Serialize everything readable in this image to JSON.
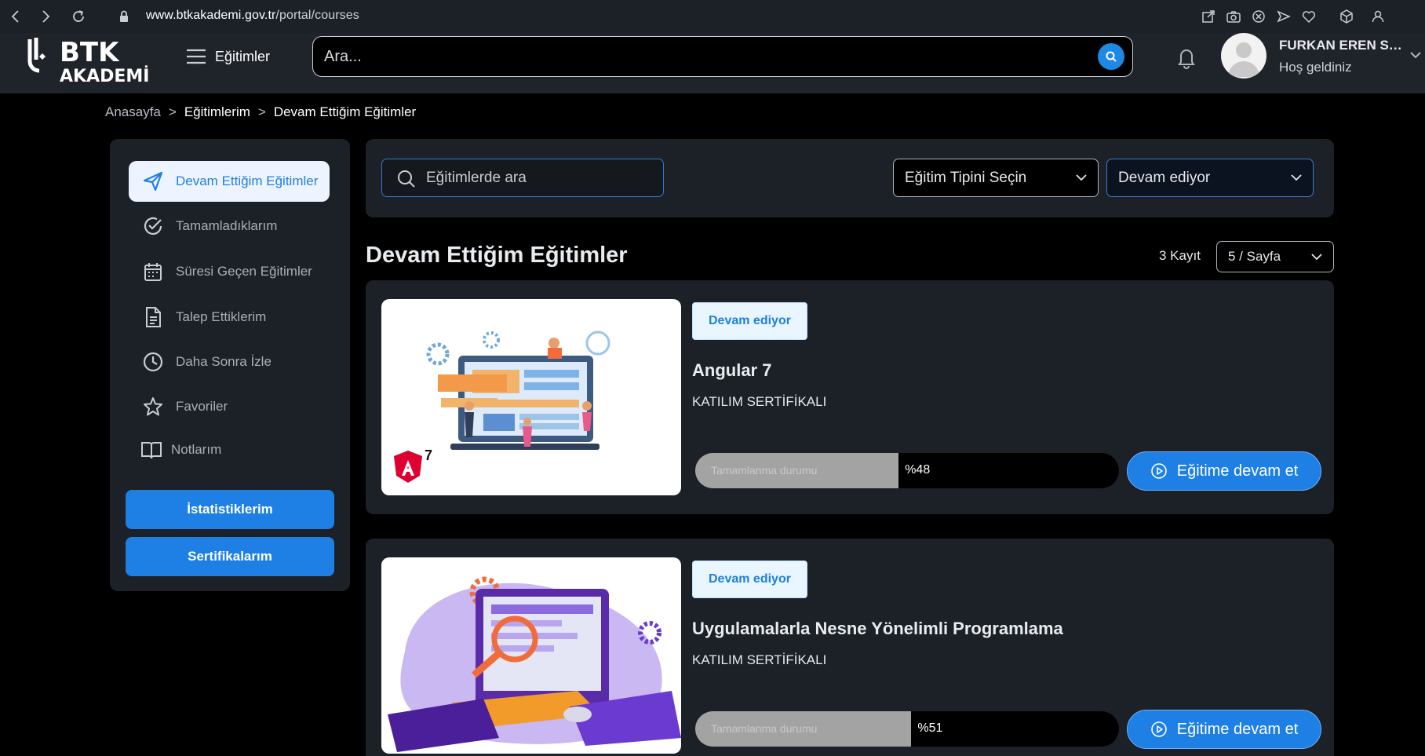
{
  "browser": {
    "url_host": "www.btkakademi.gov.tr",
    "url_path": "/portal/courses"
  },
  "header": {
    "logo_top": "BTK",
    "logo_bottom": "AKADEMİ",
    "menu_label": "Eğitimler",
    "search_placeholder": "Ara...",
    "user_name": "FURKAN EREN SA...",
    "user_greeting": "Hoş geldiniz"
  },
  "breadcrumb": {
    "items": [
      "Anasayfa",
      "Eğitimlerim",
      "Devam Ettiğim Eğitimler"
    ],
    "separator": ">"
  },
  "sidebar": {
    "items": [
      {
        "label": "Devam Ettiğim Eğitimler",
        "icon": "send-icon",
        "active": true
      },
      {
        "label": "Tamamladıklarım",
        "icon": "check-circle-icon"
      },
      {
        "label": "Süresi Geçen Eğitimler",
        "icon": "calendar-icon"
      },
      {
        "label": "Talep Ettiklerim",
        "icon": "document-icon"
      },
      {
        "label": "Daha Sonra İzle",
        "icon": "clock-icon"
      },
      {
        "label": "Favoriler",
        "icon": "star-icon"
      },
      {
        "label": "Notlarım",
        "icon": "book-icon"
      }
    ],
    "buttons": {
      "stats": "İstatistiklerim",
      "certificates": "Sertifikalarım"
    }
  },
  "filters": {
    "search_placeholder": "Eğitimlerde ara",
    "type_select": "Eğitim Tipini Seçin",
    "status_select": "Devam ediyor"
  },
  "list": {
    "title": "Devam Ettiğim Eğitimler",
    "record_count": "3 Kayıt",
    "page_size": "5 / Sayfa"
  },
  "courses": [
    {
      "status": "Devam ediyor",
      "title": "Angular 7",
      "certificate": "KATILIM SERTİFİKALI",
      "progress_label": "Tamamlanma durumu",
      "progress_text": "%48",
      "progress": 48,
      "button": "Eğitime devam et",
      "thumb_badge": "7"
    },
    {
      "status": "Devam ediyor",
      "title": "Uygulamalarla Nesne Yönelimli Programlama",
      "certificate": "KATILIM SERTİFİKALI",
      "progress_label": "Tamamlanma durumu",
      "progress_text": "%51",
      "progress": 51,
      "button": "Eğitime devam et"
    }
  ],
  "colors": {
    "accent": "#1e7fe5",
    "panel": "#1c2027",
    "background": "#000000"
  }
}
